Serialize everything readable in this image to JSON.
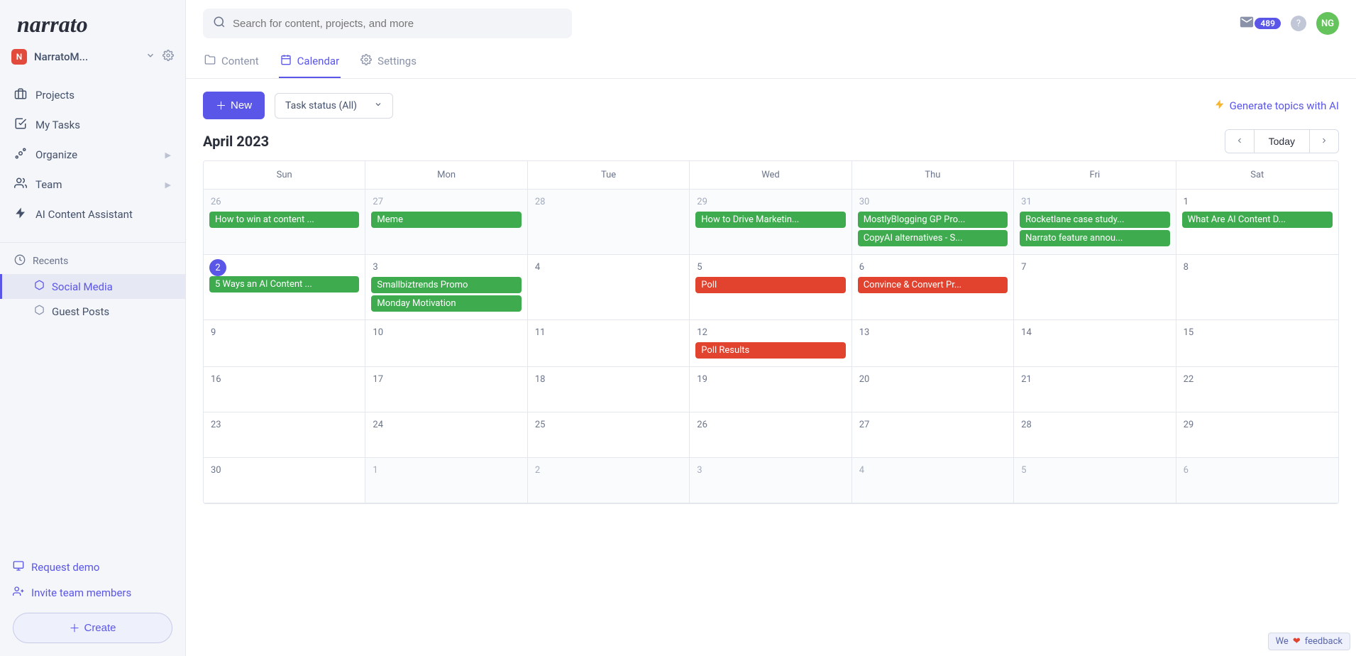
{
  "brand": "narrato",
  "workspace": {
    "badge": "N",
    "name": "NarratoM..."
  },
  "nav": {
    "projects": "Projects",
    "my_tasks": "My Tasks",
    "organize": "Organize",
    "team": "Team",
    "ai_assistant": "AI Content Assistant"
  },
  "recents": {
    "heading": "Recents",
    "items": [
      {
        "label": "Social Media"
      },
      {
        "label": "Guest Posts"
      }
    ]
  },
  "bottom": {
    "request_demo": "Request demo",
    "invite": "Invite team members",
    "create": "Create"
  },
  "search": {
    "placeholder": "Search for content, projects, and more"
  },
  "topright": {
    "mail_count": "489",
    "avatar": "NG"
  },
  "tabs": {
    "content": "Content",
    "calendar": "Calendar",
    "settings": "Settings"
  },
  "toolbar": {
    "new": "New",
    "status": "Task status (All)",
    "generate": "Generate topics with AI"
  },
  "calendar": {
    "title": "April 2023",
    "today": "Today",
    "dow": [
      "Sun",
      "Mon",
      "Tue",
      "Wed",
      "Thu",
      "Fri",
      "Sat"
    ],
    "weeks": [
      [
        {
          "n": "26",
          "other": true,
          "events": [
            {
              "t": "How to win at content ...",
              "c": "green"
            }
          ]
        },
        {
          "n": "27",
          "other": true,
          "events": [
            {
              "t": "Meme",
              "c": "green"
            }
          ]
        },
        {
          "n": "28",
          "other": true,
          "events": []
        },
        {
          "n": "29",
          "other": true,
          "events": [
            {
              "t": "How to Drive Marketin...",
              "c": "green"
            }
          ]
        },
        {
          "n": "30",
          "other": true,
          "events": [
            {
              "t": "MostlyBlogging GP Pro...",
              "c": "green"
            },
            {
              "t": "CopyAI alternatives - S...",
              "c": "green"
            }
          ]
        },
        {
          "n": "31",
          "other": true,
          "events": [
            {
              "t": "Rocketlane case study...",
              "c": "green"
            },
            {
              "t": "Narrato feature annou...",
              "c": "green"
            }
          ]
        },
        {
          "n": "1",
          "events": [
            {
              "t": "What Are AI Content D...",
              "c": "green"
            }
          ]
        }
      ],
      [
        {
          "n": "2",
          "today": true,
          "events": [
            {
              "t": "5 Ways an AI Content ...",
              "c": "green"
            }
          ]
        },
        {
          "n": "3",
          "events": [
            {
              "t": "Smallbiztrends Promo",
              "c": "green"
            },
            {
              "t": "Monday Motivation",
              "c": "green"
            }
          ]
        },
        {
          "n": "4",
          "events": []
        },
        {
          "n": "5",
          "events": [
            {
              "t": "Poll",
              "c": "red"
            }
          ]
        },
        {
          "n": "6",
          "events": [
            {
              "t": "Convince & Convert Pr...",
              "c": "red"
            }
          ]
        },
        {
          "n": "7",
          "events": []
        },
        {
          "n": "8",
          "events": []
        }
      ],
      [
        {
          "n": "9",
          "events": []
        },
        {
          "n": "10",
          "events": []
        },
        {
          "n": "11",
          "events": []
        },
        {
          "n": "12",
          "events": [
            {
              "t": "Poll Results",
              "c": "red"
            }
          ]
        },
        {
          "n": "13",
          "events": []
        },
        {
          "n": "14",
          "events": []
        },
        {
          "n": "15",
          "events": []
        }
      ],
      [
        {
          "n": "16",
          "events": []
        },
        {
          "n": "17",
          "events": []
        },
        {
          "n": "18",
          "events": []
        },
        {
          "n": "19",
          "events": []
        },
        {
          "n": "20",
          "events": []
        },
        {
          "n": "21",
          "events": []
        },
        {
          "n": "22",
          "events": []
        }
      ],
      [
        {
          "n": "23",
          "events": []
        },
        {
          "n": "24",
          "events": []
        },
        {
          "n": "25",
          "events": []
        },
        {
          "n": "26",
          "events": []
        },
        {
          "n": "27",
          "events": []
        },
        {
          "n": "28",
          "events": []
        },
        {
          "n": "29",
          "events": []
        }
      ],
      [
        {
          "n": "30",
          "events": []
        },
        {
          "n": "1",
          "other": true,
          "events": []
        },
        {
          "n": "2",
          "other": true,
          "events": []
        },
        {
          "n": "3",
          "other": true,
          "events": []
        },
        {
          "n": "4",
          "other": true,
          "events": []
        },
        {
          "n": "5",
          "other": true,
          "events": []
        },
        {
          "n": "6",
          "other": true,
          "events": []
        }
      ]
    ]
  },
  "feedback": {
    "we": "We",
    "text": "feedback"
  }
}
